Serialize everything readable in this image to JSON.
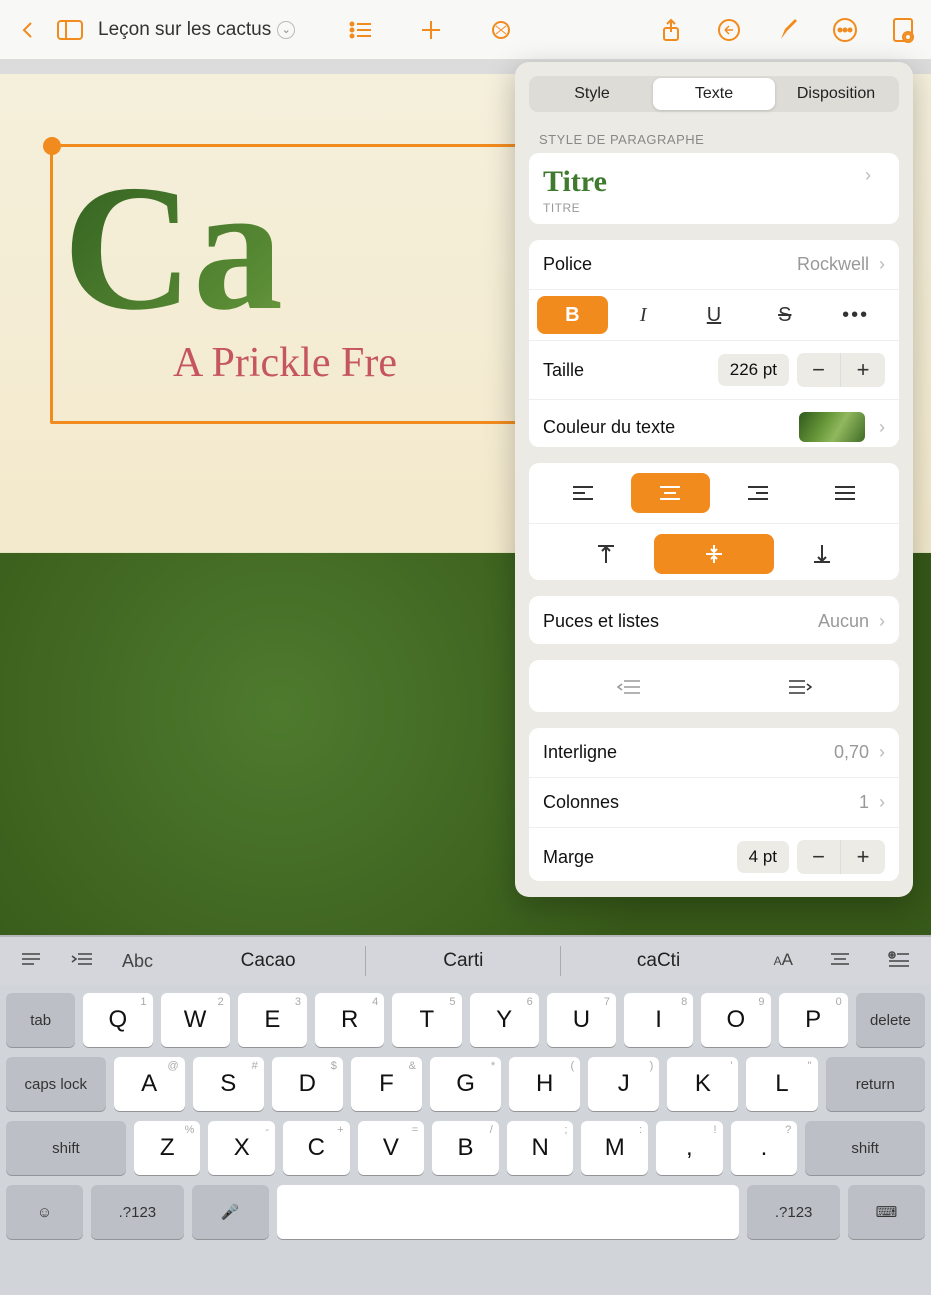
{
  "toolbar": {
    "document_title": "Leçon sur les cactus"
  },
  "document": {
    "title_text": "Ca",
    "subtitle_text": "A Prickle Fre"
  },
  "panel": {
    "tabs": {
      "style": "Style",
      "text": "Texte",
      "layout": "Disposition"
    },
    "section_paragraph_style": "STYLE DE PARAGRAPHE",
    "paragraph_style_name": "Titre",
    "paragraph_style_caption": "TITRE",
    "font_label": "Police",
    "font_value": "Rockwell",
    "format": {
      "bold": "B",
      "italic": "I",
      "underline": "U",
      "strike": "S",
      "more": "•••"
    },
    "size_label": "Taille",
    "size_value": "226 pt",
    "text_color_label": "Couleur du texte",
    "bullets_label": "Puces et listes",
    "bullets_value": "Aucun",
    "line_spacing_label": "Interligne",
    "line_spacing_value": "0,70",
    "columns_label": "Colonnes",
    "columns_value": "1",
    "margin_label": "Marge",
    "margin_value": "4 pt"
  },
  "kb_bar": {
    "abc": "Abc",
    "suggestions": [
      "Cacao",
      "Carti",
      "caCti"
    ]
  },
  "keyboard": {
    "row1": [
      {
        "m": "Q",
        "a": "1"
      },
      {
        "m": "W",
        "a": "2"
      },
      {
        "m": "E",
        "a": "3"
      },
      {
        "m": "R",
        "a": "4"
      },
      {
        "m": "T",
        "a": "5"
      },
      {
        "m": "Y",
        "a": "6"
      },
      {
        "m": "U",
        "a": "7"
      },
      {
        "m": "I",
        "a": "8"
      },
      {
        "m": "O",
        "a": "9"
      },
      {
        "m": "P",
        "a": "0"
      }
    ],
    "row2": [
      {
        "m": "A",
        "a": "@"
      },
      {
        "m": "S",
        "a": "#"
      },
      {
        "m": "D",
        "a": "$"
      },
      {
        "m": "F",
        "a": "&"
      },
      {
        "m": "G",
        "a": "*"
      },
      {
        "m": "H",
        "a": "("
      },
      {
        "m": "J",
        "a": ")"
      },
      {
        "m": "K",
        "a": "'"
      },
      {
        "m": "L",
        "a": "\""
      }
    ],
    "row3": [
      {
        "m": "Z",
        "a": "%"
      },
      {
        "m": "X",
        "a": "-"
      },
      {
        "m": "C",
        "a": "+"
      },
      {
        "m": "V",
        "a": "="
      },
      {
        "m": "B",
        "a": "/"
      },
      {
        "m": "N",
        "a": ";"
      },
      {
        "m": "M",
        "a": ":"
      },
      {
        "m": ",",
        "a": "!"
      },
      {
        "m": ".",
        "a": "?"
      }
    ],
    "fn": {
      "tab": "tab",
      "delete": "delete",
      "caps": "caps lock",
      "return": "return",
      "shift": "shift",
      "num": ".?123"
    }
  }
}
